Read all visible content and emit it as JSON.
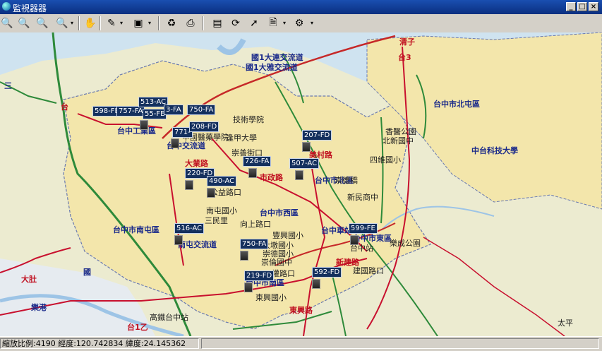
{
  "window": {
    "title": "監視器器",
    "minimize": "_",
    "maximize": "□",
    "close": "×"
  },
  "toolbar": {
    "icons": [
      "zoom-icon",
      "zoom-in-icon",
      "zoom-out-icon",
      "zoom-select-icon",
      "pan-hand-icon",
      "tool-icon",
      "layer-icon",
      "refresh-icon",
      "print-icon",
      "camera-list-icon",
      "sync-icon",
      "pointer-icon",
      "document-icon",
      "settings-gear-icon"
    ],
    "dropdown_glyph": "▾"
  },
  "map": {
    "colors": {
      "water": "#cfe3f0",
      "land": "#f3e6ab",
      "highway": "#2e8a3a",
      "arterial": "#c8102e",
      "rail": "#c62828",
      "river": "#9dc4e6",
      "boundary": "#6a7ab0"
    },
    "cameras": [
      {
        "id": "598-FB"
      },
      {
        "id": "757-FA"
      },
      {
        "id": "513-AC"
      },
      {
        "id": "55-FE"
      },
      {
        "id": "3-FA"
      },
      {
        "id": "750-FA"
      },
      {
        "id": "771-"
      },
      {
        "id": "208-FD"
      },
      {
        "id": "207-FD"
      },
      {
        "id": "726-FA"
      },
      {
        "id": "507-AC"
      },
      {
        "id": "220-FD"
      },
      {
        "id": "490-AC"
      },
      {
        "id": "516-AC"
      },
      {
        "id": "599-FE"
      },
      {
        "id": "750-FA"
      },
      {
        "id": "219-FD"
      },
      {
        "id": "592-FD"
      }
    ],
    "labels": {
      "l1": "台中市北屯區",
      "l2": "中台科技大學",
      "l3": "台中市北區",
      "l4": "台中市西區",
      "l5": "台中市南屯區",
      "l6": "台中市南區",
      "l7": "台中市東區",
      "l8": "逢甲大學",
      "l9": "中國醫藥學院",
      "l10": "技術學院",
      "l11": "新民商中",
      "l12": "樂成公園",
      "l13": "南屯國小",
      "l14": "向上路口",
      "l15": "東興國小",
      "l16": "三民里",
      "l17": "四維國小",
      "l18": "北新國中",
      "l19": "香醫公園",
      "l20": "崇德橋",
      "l21": "國1大連交流道",
      "l22": "國1大雅交流道",
      "l23": "台中交流道",
      "l24": "南屯交流道",
      "l25": "台中站",
      "l26": "崇倫國中",
      "l27": "崇德國小",
      "l28": "大墩國小",
      "l29": "建國路口",
      "l30": "台中車站",
      "l31": "五權路口",
      "l32": "美村路",
      "l33": "豐興國小",
      "l34": "太平",
      "l35": "清子",
      "l36": "崇善街口",
      "l37": "大業路",
      "l38": "台中工業區",
      "l39": "公益路口",
      "l40": "樂港",
      "l41": "高鐵台中站",
      "l42": "東興路",
      "l43": "大肚",
      "l44": "台1乙",
      "l45": "市政路",
      "l46": "新建路",
      "l47": "三",
      "l48": "台3",
      "l49": "台",
      "l50": "國"
    }
  },
  "status": {
    "text": "縮放比例:4190 經度:120.742834 緯度:24.145362"
  }
}
